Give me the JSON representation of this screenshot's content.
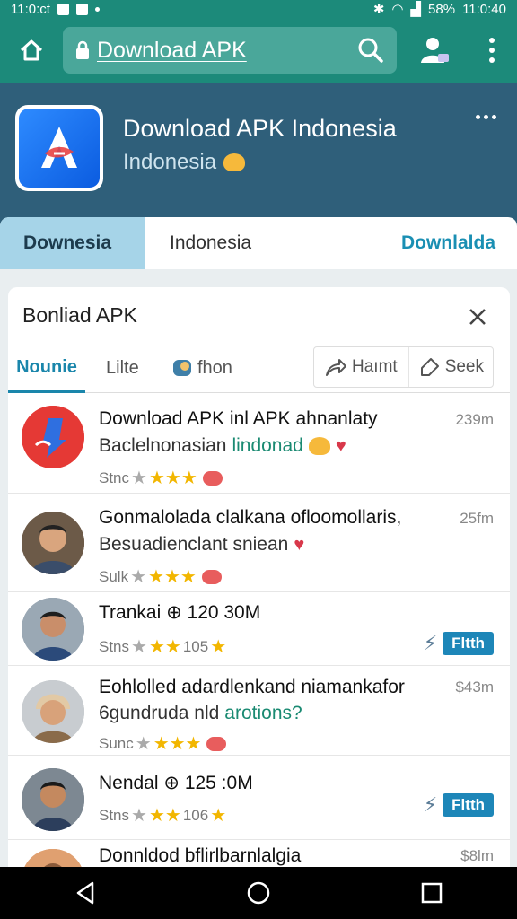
{
  "status_bar": {
    "left_text": "11:0:ct",
    "battery": "58%",
    "time": "11:0:40"
  },
  "app_bar": {
    "url": "Download APK"
  },
  "app": {
    "title": "Download APK Indonesia",
    "subtitle": "Indonesia"
  },
  "tabs": [
    {
      "label": "Downesia"
    },
    {
      "label": "Indonesia"
    },
    {
      "label": "Downlalda"
    }
  ],
  "card": {
    "title": "Bonliad APK",
    "filters": [
      "Nounie",
      "Lilte",
      "fhon"
    ],
    "actions": [
      "Haımt",
      "Seek"
    ]
  },
  "items": [
    {
      "title": "Download APK inl APK ahnanlaty",
      "sub": "Baclelnonasian",
      "sub_highlight": "lindonad",
      "meta": "Stnc",
      "size": "239m"
    },
    {
      "title": "Gonmalolada clalkana ofloomollaris,",
      "sub": "Besuadienclant sniean",
      "meta": "Sulk",
      "size": "25fm"
    },
    {
      "title": "Trankai ⊕ 120 30M",
      "meta": "Stns",
      "meta_num": "105",
      "badge": "Fltth"
    },
    {
      "title": "Eohlolled adardlenkand niamankafor",
      "sub": "6gundruda nld",
      "sub_highlight": "arotions?",
      "meta": "Sunc",
      "size": "$43m"
    },
    {
      "title": "Nendal ⊕ 125 :0M",
      "meta": "Stns",
      "meta_num": "106",
      "badge": "Fltth"
    },
    {
      "title": "Donnldod bflirlbarnlalgia",
      "size": "$8lm"
    }
  ],
  "colors": {
    "app_bar": "#1c8a7a",
    "header": "#2f5f7a",
    "accent": "#1a86ab"
  }
}
